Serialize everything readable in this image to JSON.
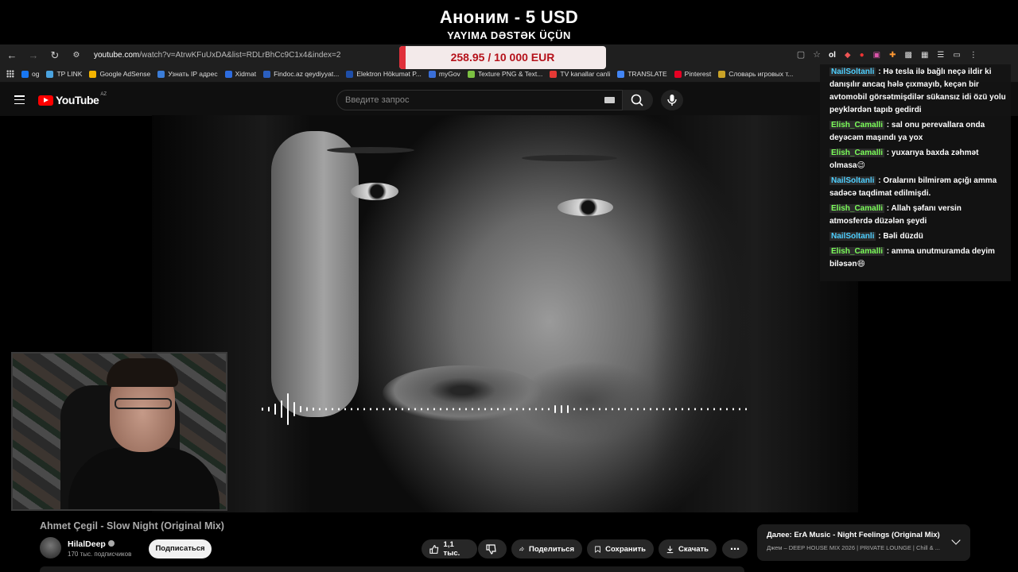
{
  "donation": {
    "title": "Аноним - 5 USD",
    "subtitle": "YAYIMA DƏSTƏK ÜÇÜN"
  },
  "goal": {
    "text": "258.95 / 10 000 EUR",
    "progress": 0.026
  },
  "browser": {
    "url_host": "youtube.com",
    "url_path": "/watch?v=AtrwKFuUxDA&list=RDLrBhCc9C1x4&index=2",
    "bookmarks": [
      {
        "label": "og",
        "color": "#1877f2"
      },
      {
        "label": "TP LINK",
        "color": "#4aa3df"
      },
      {
        "label": "Google AdSense",
        "color": "#f4b400"
      },
      {
        "label": "Узнать IP адрес",
        "color": "#3b7dd8"
      },
      {
        "label": "Xidmat",
        "color": "#2d6cdf"
      },
      {
        "label": "Findoc.az qeydiyyat...",
        "color": "#2b5fbf"
      },
      {
        "label": "Elektron Hökumət P...",
        "color": "#1e4ea8"
      },
      {
        "label": "myGov",
        "color": "#3a6fd8"
      },
      {
        "label": "Texture PNG & Text...",
        "color": "#7cc142"
      },
      {
        "label": "TV kanallar canli",
        "color": "#e53935"
      },
      {
        "label": "TRANSLATE",
        "color": "#4285f4"
      },
      {
        "label": "Pinterest",
        "color": "#e60023"
      },
      {
        "label": "Словарь игровых т...",
        "color": "#c9a227"
      }
    ]
  },
  "youtube": {
    "logo_text": "YouTube",
    "region": "AZ",
    "search_placeholder": "Введите запрос"
  },
  "chat": {
    "header": "ol",
    "messages": [
      {
        "user": "NailSoltanli",
        "color": "blue",
        "text": ": Hə tesla ilə bağlı neçə ildir ki danışılır ancaq hələ çıxmayıb, keçən bir avtomobil görsətmişdilər sükansız idi özü yolu peyklərdən tapıb gedirdi"
      },
      {
        "user": "Elish_Camalli",
        "color": "green",
        "text": ": sal onu perevallara onda deyəcəm maşındı ya yox"
      },
      {
        "user": "Elish_Camalli",
        "color": "green",
        "text": ": yuxarıya baxda zəhmət olmasa😉"
      },
      {
        "user": "NailSoltanli",
        "color": "blue",
        "text": ": Oralarını bilmirəm açığı amma sadəcə taqdimat edilmişdi."
      },
      {
        "user": "Elish_Camalli",
        "color": "green",
        "text": ": Allah şəfanı versin atmosferdə düzələn şeydi"
      },
      {
        "user": "NailSoltanli",
        "color": "blue",
        "text": ": Bəli düzdü"
      },
      {
        "user": "Elish_Camalli",
        "color": "green",
        "text": ": amma unutmuramda deyim biləsən😄"
      }
    ]
  },
  "video": {
    "title": "Ahmet Çegil - Slow Night (Original Mix)",
    "channel": "HilalDeep",
    "subscribers": "170 тыс. подписчиков",
    "subscribe_label": "Подписаться",
    "likes": "1,1 тыс.",
    "share_label": "Поделиться",
    "save_label": "Сохранить",
    "download_label": "Скачать"
  },
  "up_next": {
    "title": "Далее: ErA Music - Night Feelings (Original Mix)",
    "subtitle": "Джем – DEEP HOUSE MIX 2026 | PRIVATE LOUNGE | Chill & ..."
  },
  "colors": {
    "accent": "#ff0000",
    "goal_fill": "#e0303a",
    "chat_green": "#7cff5a",
    "chat_blue": "#4ecfff"
  }
}
